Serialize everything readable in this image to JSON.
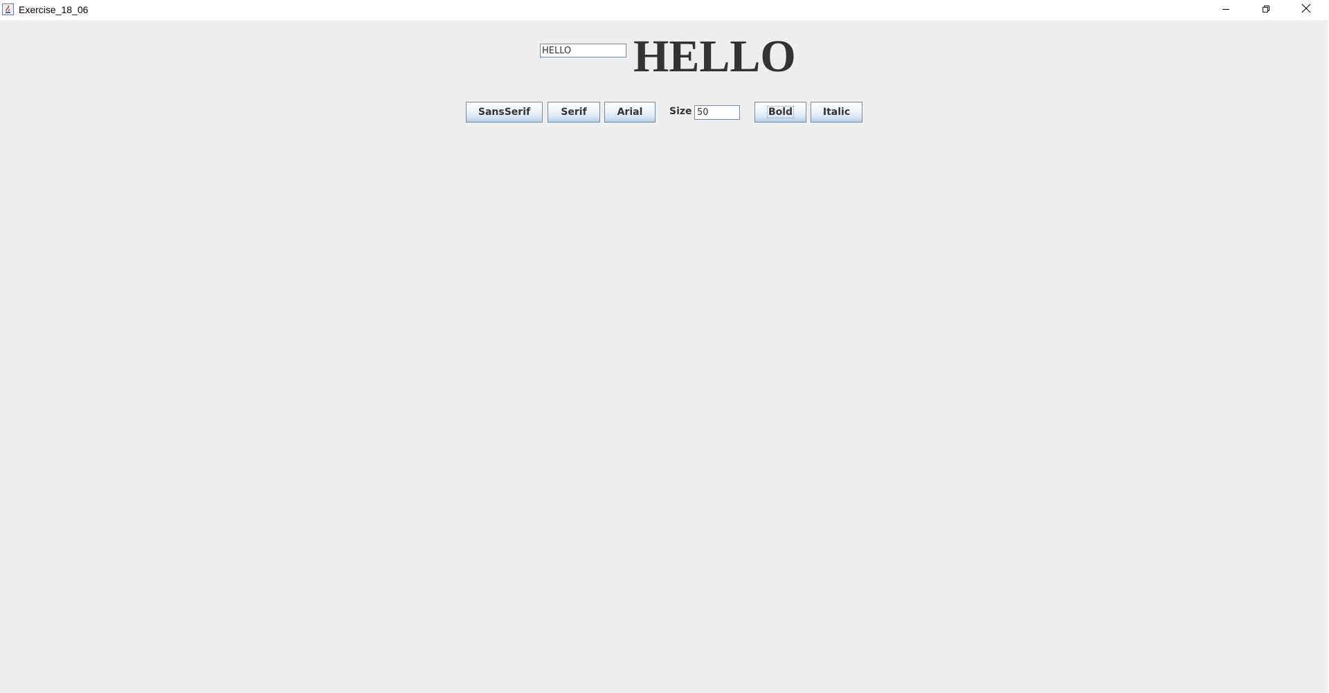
{
  "window": {
    "title": "Exercise_18_06"
  },
  "title_bar": {
    "icons": {
      "app": "java-app-icon",
      "minimize": "minimize-icon",
      "maximize": "restore-icon",
      "close": "close-icon"
    }
  },
  "top_row": {
    "text_field_value": "HELLO",
    "display_label": "HELLO"
  },
  "controls": {
    "sansserif_label": "SansSerif",
    "serif_label": "Serif",
    "arial_label": "Arial",
    "size_label": "Size",
    "size_value": "50",
    "bold_label": "Bold",
    "italic_label": "Italic"
  },
  "colors": {
    "content_background": "#eeeeee",
    "text": "#333333",
    "button_border": "#7a8a99"
  }
}
